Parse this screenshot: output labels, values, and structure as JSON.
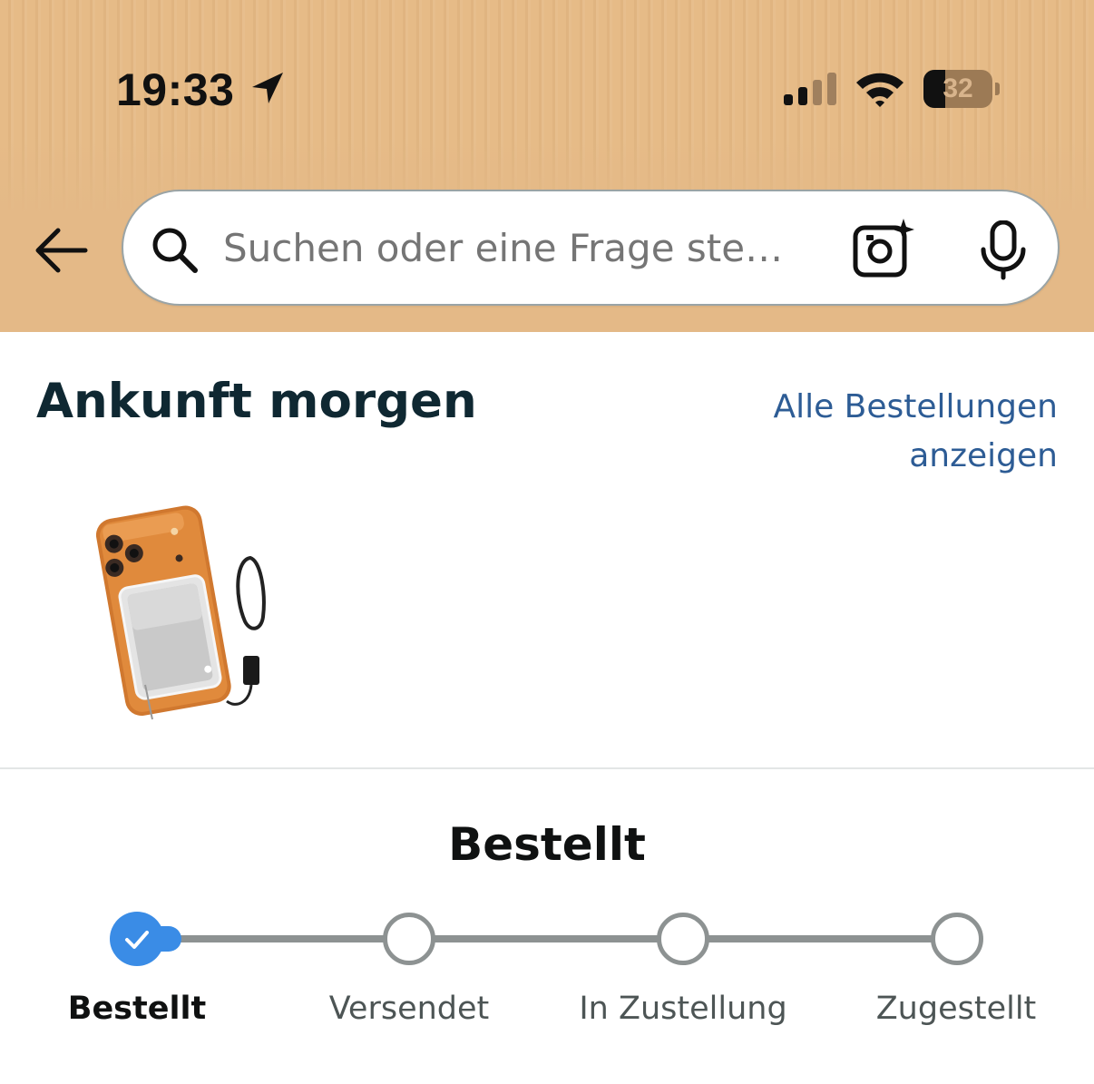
{
  "status_bar": {
    "time": "19:33",
    "battery_level": "32",
    "battery_fraction": 0.32,
    "icons": [
      "location-arrow-icon",
      "cellular-signal-icon",
      "wifi-icon",
      "battery-icon"
    ]
  },
  "header": {
    "back_icon": "back-arrow-icon",
    "search": {
      "placeholder": "Suchen oder eine Frage ste…",
      "icons": [
        "search-icon",
        "camera-lens-icon",
        "microphone-icon"
      ]
    }
  },
  "arrival": {
    "title": "Ankunft morgen",
    "all_orders_line1": "Alle Bestellungen",
    "all_orders_line2": "anzeigen"
  },
  "tracking": {
    "current_status": "Bestellt",
    "steps": [
      {
        "label": "Bestellt",
        "done": true
      },
      {
        "label": "Versendet",
        "done": false
      },
      {
        "label": "In Zustellung",
        "done": false
      },
      {
        "label": "Zugestellt",
        "done": false
      }
    ]
  },
  "colors": {
    "header_bg": "#e6bb87",
    "link": "#2d5c95",
    "title": "#0f2832",
    "progress_done": "#3a8ce6",
    "progress_track": "#8d9292"
  }
}
